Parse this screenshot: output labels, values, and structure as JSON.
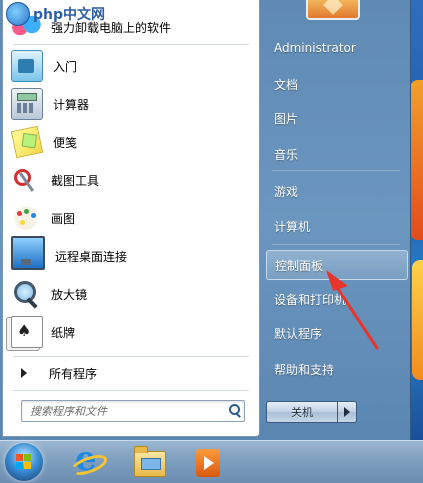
{
  "watermark": {
    "text": "php中文网"
  },
  "left_pane": {
    "items": [
      {
        "label": "强力卸载电脑上的软件",
        "icon": "uninstall-gallery-icon"
      },
      {
        "label": "入门",
        "icon": "getting-started-icon"
      },
      {
        "label": "计算器",
        "icon": "calculator-icon"
      },
      {
        "label": "便笺",
        "icon": "sticky-notes-icon"
      },
      {
        "label": "截图工具",
        "icon": "snipping-tool-icon"
      },
      {
        "label": "画图",
        "icon": "paint-icon"
      },
      {
        "label": "远程桌面连接",
        "icon": "remote-desktop-icon"
      },
      {
        "label": "放大镜",
        "icon": "magnifier-icon"
      },
      {
        "label": "纸牌",
        "icon": "solitaire-icon"
      }
    ],
    "all_programs": "所有程序",
    "search_placeholder": "搜索程序和文件"
  },
  "right_pane": {
    "user": "Administrator",
    "items": [
      {
        "label": "文档"
      },
      {
        "label": "图片"
      },
      {
        "label": "音乐"
      },
      {
        "label": "游戏"
      },
      {
        "label": "计算机"
      },
      {
        "label": "控制面板"
      },
      {
        "label": "设备和打印机"
      },
      {
        "label": "默认程序"
      },
      {
        "label": "帮助和支持"
      }
    ],
    "highlighted": "控制面板",
    "shutdown_label": "关机"
  },
  "taskbar": {
    "pinned": [
      "internet-explorer-icon",
      "windows-explorer-icon",
      "media-player-icon"
    ]
  },
  "colors": {
    "annotation_arrow": "#e8352b",
    "menu_blue": "#5f8ab4"
  }
}
